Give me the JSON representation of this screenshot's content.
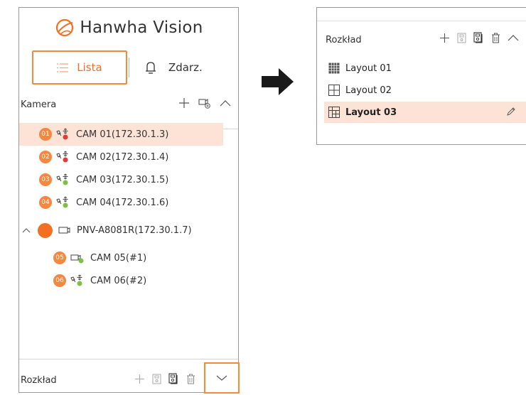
{
  "brand": {
    "name": "Hanwha Vision"
  },
  "view_tabs": {
    "list_label": "Lista",
    "events_label": "Zdarz."
  },
  "camera_section": {
    "title": "Kamera",
    "items": [
      {
        "badge": "01",
        "label": "CAM 01(172.30.1.3)",
        "status": "red",
        "selected": true
      },
      {
        "badge": "02",
        "label": "CAM 02(172.30.1.4)",
        "status": "red"
      },
      {
        "badge": "03",
        "label": "CAM 03(172.30.1.5)",
        "status": "green"
      },
      {
        "badge": "04",
        "label": "CAM 04(172.30.1.6)",
        "status": "green"
      }
    ],
    "group": {
      "label": "PNV-A8081R(172.30.1.7)",
      "children": [
        {
          "badge": "05",
          "label": "CAM 05(#1)",
          "status": "green"
        },
        {
          "badge": "06",
          "label": "CAM 06(#2)",
          "status": "green"
        }
      ]
    }
  },
  "layout_section": {
    "title": "Rozkład",
    "items": [
      {
        "label": "Layout 01",
        "selected": false
      },
      {
        "label": "Layout 02",
        "selected": false
      },
      {
        "label": "Layout 03",
        "selected": true
      }
    ]
  },
  "colors": {
    "accent": "#f36f21",
    "selected_bg": "#fde3d6",
    "status_red": "#e53935",
    "status_green": "#7cc242"
  },
  "icons": [
    "logo-icon",
    "list-icon",
    "bell-icon",
    "plus-icon",
    "camera-add-icon",
    "chevron-up-icon",
    "chevron-down-icon",
    "save-icon",
    "save-as-icon",
    "trash-icon",
    "layout-grid-icon",
    "pencil-icon",
    "arrow-right-icon"
  ]
}
